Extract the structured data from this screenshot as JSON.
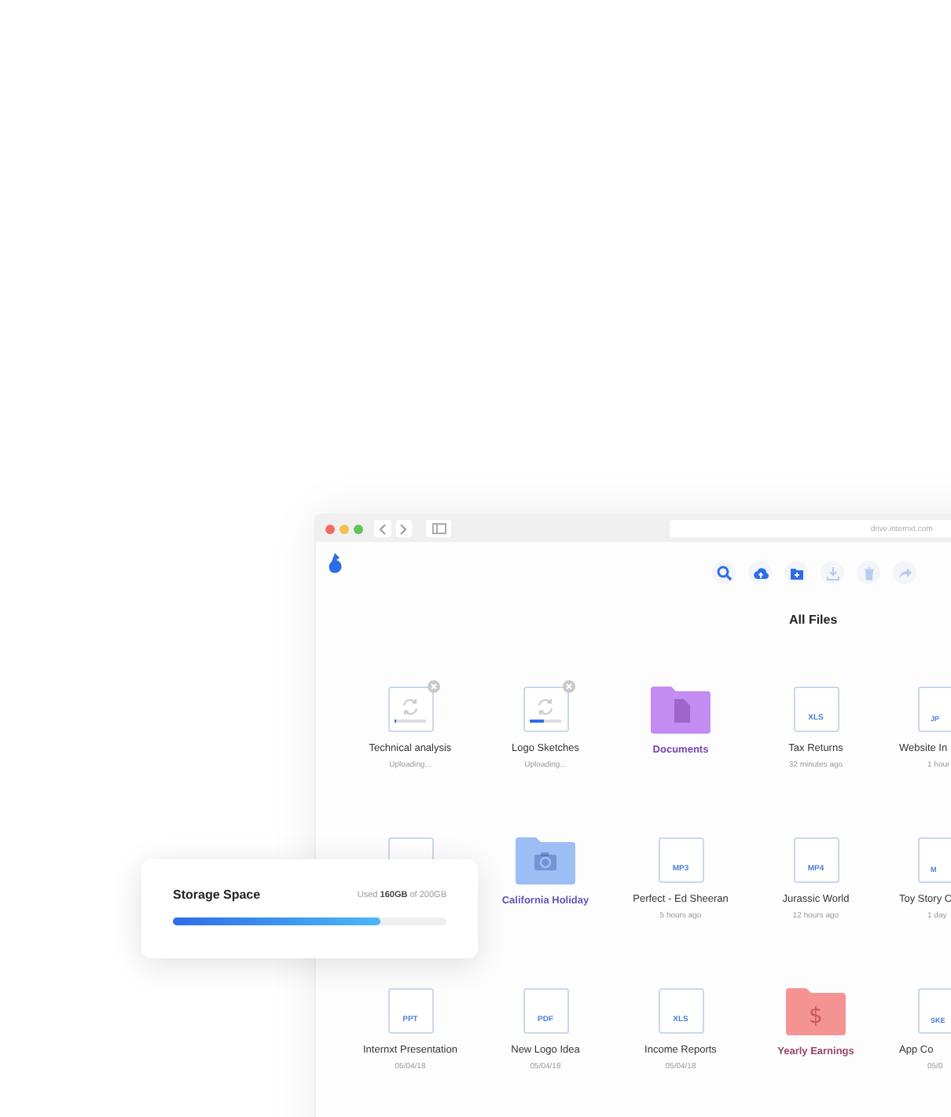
{
  "browser": {
    "url": "drive.internxt.com"
  },
  "toolbar": [
    {
      "enabled": true
    },
    {
      "enabled": true
    },
    {
      "enabled": true
    },
    {
      "enabled": false
    },
    {
      "enabled": false
    },
    {
      "enabled": false
    }
  ],
  "title": "All Files",
  "files": [
    {
      "kind": "uploading",
      "name": "Technical analysis",
      "sub": "Uploading...",
      "level": 0.05
    },
    {
      "kind": "uploading",
      "name": "Logo Sketches",
      "sub": "Uploading...",
      "level": 0.45
    },
    {
      "kind": "document-folder",
      "name": "Documents",
      "color": "#c38cf0"
    },
    {
      "kind": "file",
      "name": "Tax Returns",
      "sub": "32 minutes ago",
      "type": "XLS"
    },
    {
      "kind": "file",
      "name": "Website In",
      "sub": "1 hour",
      "type": "JP"
    },
    {
      "kind": "covered"
    },
    {
      "kind": "photo-folder",
      "name": "California Holiday",
      "color": "#9dbdf5"
    },
    {
      "kind": "file",
      "name": "Perfect - Ed Sheeran",
      "sub": "5 hours ago",
      "type": "MP3"
    },
    {
      "kind": "file",
      "name": "Jurassic World",
      "sub": "12 hours ago",
      "type": "MP4"
    },
    {
      "kind": "file",
      "name": "Toy Story C",
      "sub": "1 day",
      "type": "M"
    },
    {
      "kind": "file",
      "name": "Internxt Presentation",
      "sub": "05/04/18",
      "type": "PPT"
    },
    {
      "kind": "file",
      "name": "New Logo Idea",
      "sub": "05/04/18",
      "type": "PDF"
    },
    {
      "kind": "file",
      "name": "Income Reports",
      "sub": "05/04/18",
      "type": "XLS"
    },
    {
      "kind": "money-folder",
      "name": "Yearly Earnings",
      "glyph": "$",
      "color": "#f59393"
    },
    {
      "kind": "file",
      "name": "App Co",
      "sub": "05/0",
      "type": "SKE"
    }
  ],
  "storage": {
    "title": "Storage Space",
    "usage": "Used **160GB** of 200GB",
    "level": 0.76
  }
}
